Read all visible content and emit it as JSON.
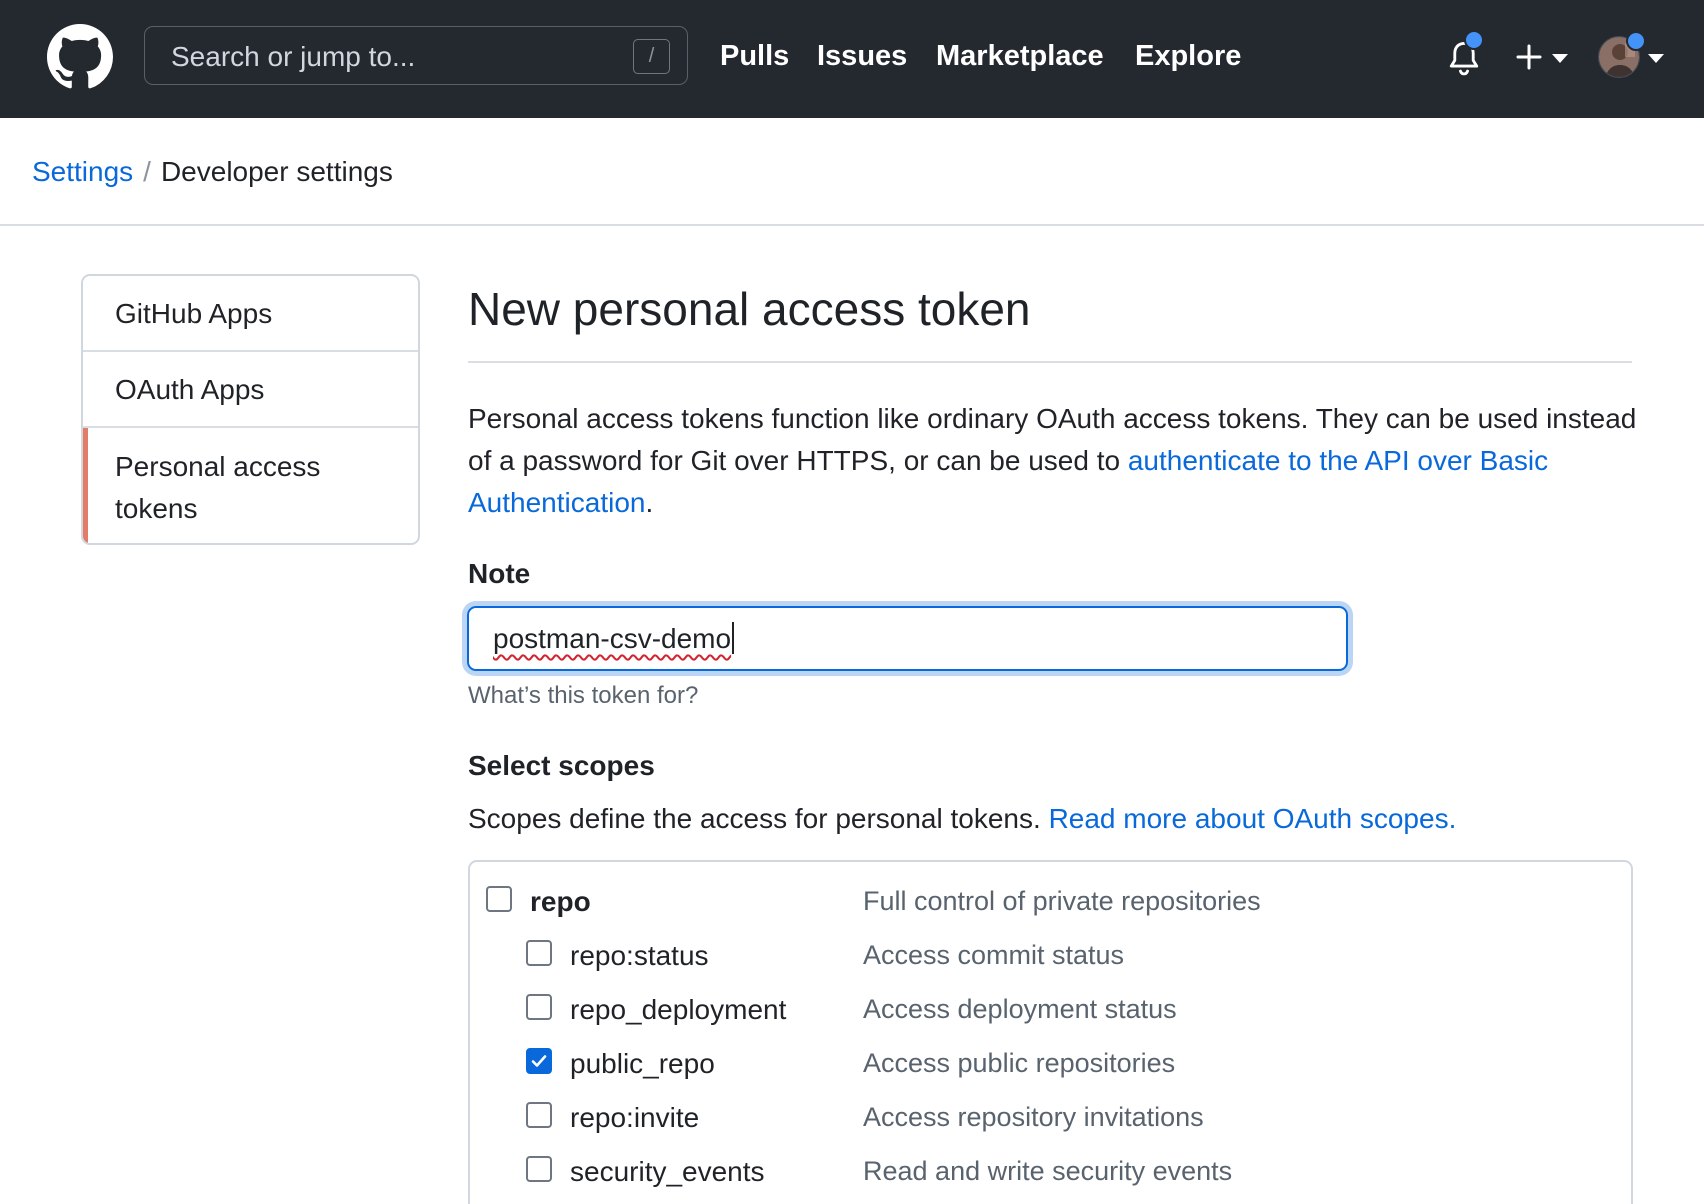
{
  "header": {
    "search_placeholder": "Search or jump to...",
    "search_shortcut": "/",
    "nav": [
      "Pulls",
      "Issues",
      "Marketplace",
      "Explore"
    ]
  },
  "breadcrumb": {
    "parent": "Settings",
    "separator": "/",
    "current": "Developer settings"
  },
  "sidebar": {
    "items": [
      {
        "label": "GitHub Apps"
      },
      {
        "label": "OAuth Apps"
      },
      {
        "label_line1": "Personal access",
        "label_line2": "tokens",
        "active": true
      }
    ]
  },
  "main": {
    "title": "New personal access token",
    "intro_text": "Personal access tokens function like ordinary OAuth access tokens. They can be used instead of a password for Git over HTTPS, or can be used to ",
    "intro_link": "authenticate to the API over Basic Authentication",
    "intro_end": ".",
    "note": {
      "label": "Note",
      "value": "postman-csv-demo",
      "help": "What’s this token for?"
    },
    "scopes": {
      "title": "Select scopes",
      "desc": "Scopes define the access for personal tokens. ",
      "desc_link": "Read more about OAuth scopes.",
      "items": [
        {
          "name": "repo",
          "description": "Full control of private repositories",
          "checked": false
        },
        {
          "name": "repo:status",
          "description": "Access commit status",
          "checked": false
        },
        {
          "name": "repo_deployment",
          "description": "Access deployment status",
          "checked": false
        },
        {
          "name": "public_repo",
          "description": "Access public repositories",
          "checked": true
        },
        {
          "name": "repo:invite",
          "description": "Access repository invitations",
          "checked": false
        },
        {
          "name": "security_events",
          "description": "Read and write security events",
          "checked": false
        }
      ]
    }
  },
  "colors": {
    "header_bg": "#24292f",
    "link": "#0969da",
    "active_marker": "#e27b67",
    "notification_dot": "#4493f8"
  }
}
